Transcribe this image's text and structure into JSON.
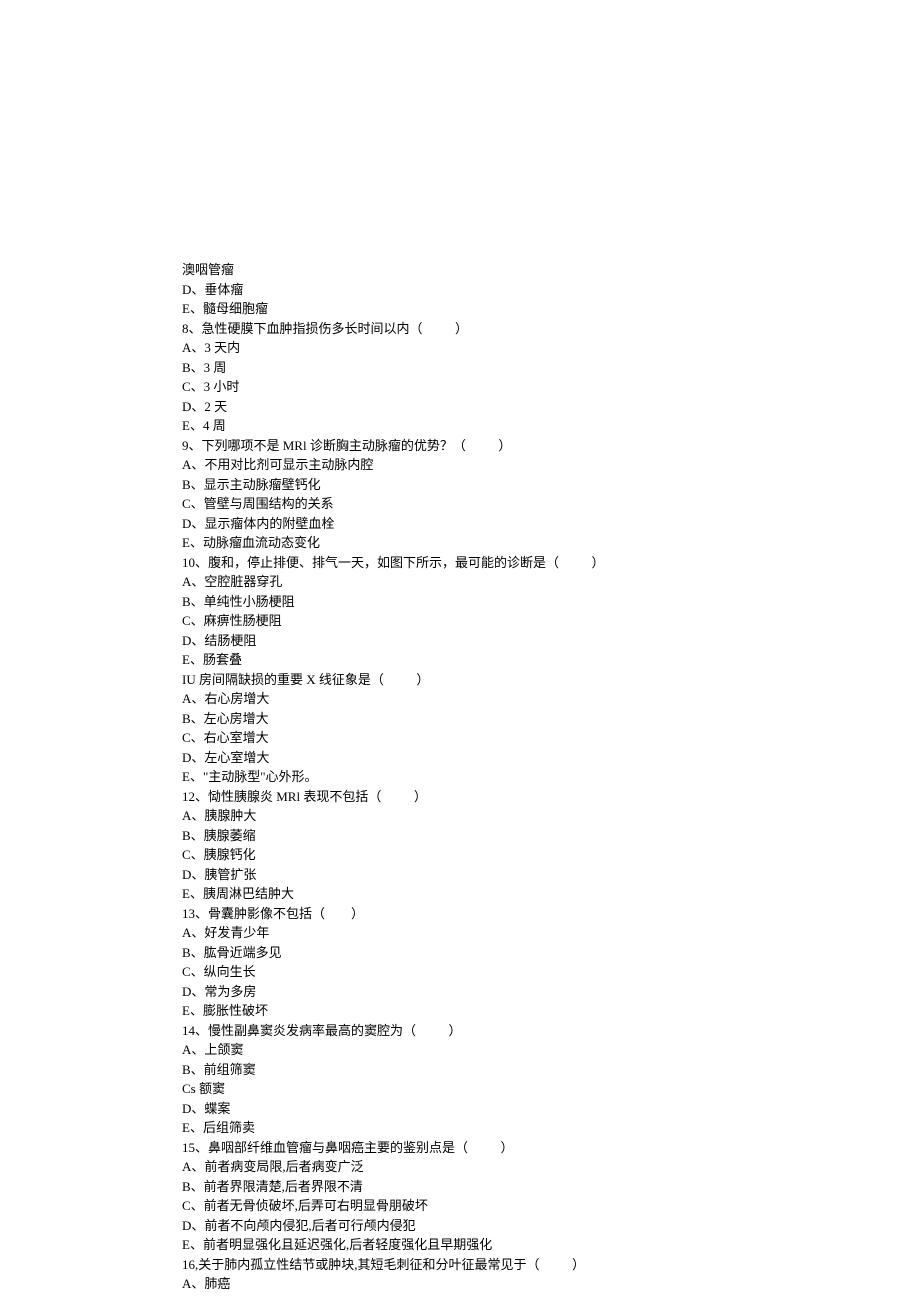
{
  "lines": [
    "澳咽管瘤",
    "D、垂体瘤",
    "E、髓母细胞瘤",
    "8、急性硬膜下血肿指损伤多长时间以内（          ）",
    "A、3 天内",
    "B、3 周",
    "C、3 小时",
    "D、2 天",
    "E、4 周",
    "9、下列哪项不是 MRl 诊断胸主动脉瘤的优势？（          ）",
    "A、不用对比剂可显示主动脉内腔",
    "B、显示主动脉瘤壁钙化",
    "C、管壁与周围结构的关系",
    "D、显示瘤体内的附壁血栓",
    "E、动脉瘤血流动态变化",
    "10、腹和，停止排便、排气一天，如图下所示，最可能的诊断是（          ）",
    "A、空腔脏器穿孔",
    "B、单纯性小肠梗阻",
    "C、麻痹性肠梗阻",
    "D、结肠梗阻",
    "E、肠套叠",
    "IU 房间隔缺损的重要 X 线征象是（          ）",
    "A、右心房增大",
    "B、左心房增大",
    "C、右心室增大",
    "D、左心室增大",
    "E、\"主动脉型\"心外形。",
    "12、恸性胰腺炎 MRl 表现不包括（          ）",
    "A、胰腺肿大",
    "B、胰腺萎缩",
    "C、胰腺钙化",
    "D、胰管扩张",
    "E、胰周淋巴结肿大",
    "13、骨囊肿影像不包括（        ）",
    "A、好发青少年",
    "B、肱骨近端多见",
    "C、纵向生长",
    "D、常为多房",
    "E、膨胀性破坏",
    "14、慢性副鼻窦炎发病率最高的窦腔为（          ）",
    "A、上颌窦",
    "B、前组筛窦",
    "Cs 额窦",
    "D、蝶案",
    "E、后组筛卖",
    "15、鼻咽部纤维血管瘤与鼻咽癌主要的鉴别点是（          ）",
    "A、前者病变局限,后者病变广泛",
    "B、前者界限清楚,后者界限不清",
    "C、前者无骨侦破坏,后弄可右明显骨朋破坏",
    "D、前者不向颅内侵犯,后者可行颅内侵犯",
    "E、前者明显强化且延迟强化,后者轻度强化且早期强化",
    "16,关于肺内孤立性结节或肿块,其短毛刺征和分叶征最常见于（          ）",
    "A、肺癌"
  ]
}
